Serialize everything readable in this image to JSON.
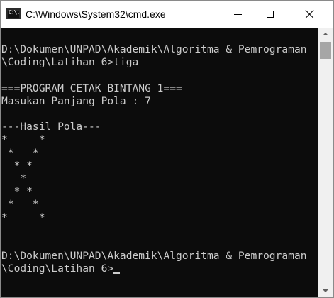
{
  "window": {
    "title": "C:\\Windows\\System32\\cmd.exe",
    "icon_label": "C:\\."
  },
  "controls": {
    "minimize": "minimize-icon",
    "maximize": "maximize-icon",
    "close": "close-icon"
  },
  "console": {
    "lines": [
      "D:\\Dokumen\\UNPAD\\Akademik\\Algoritma & Pemrograman",
      "\\Coding\\Latihan 6>tiga",
      "",
      "===PROGRAM CETAK BINTANG 1===",
      "Masukan Panjang Pola : 7",
      "",
      "---Hasil Pola---",
      "*     *",
      " *   *",
      "  * *",
      "   *",
      "  * *",
      " *   *",
      "*     *",
      "",
      "",
      "D:\\Dokumen\\UNPAD\\Akademik\\Algoritma & Pemrograman",
      "\\Coding\\Latihan 6>"
    ]
  },
  "colors": {
    "console_background": "#0c0c0c",
    "console_text": "#cccccc",
    "titlebar_background": "#ffffff"
  }
}
